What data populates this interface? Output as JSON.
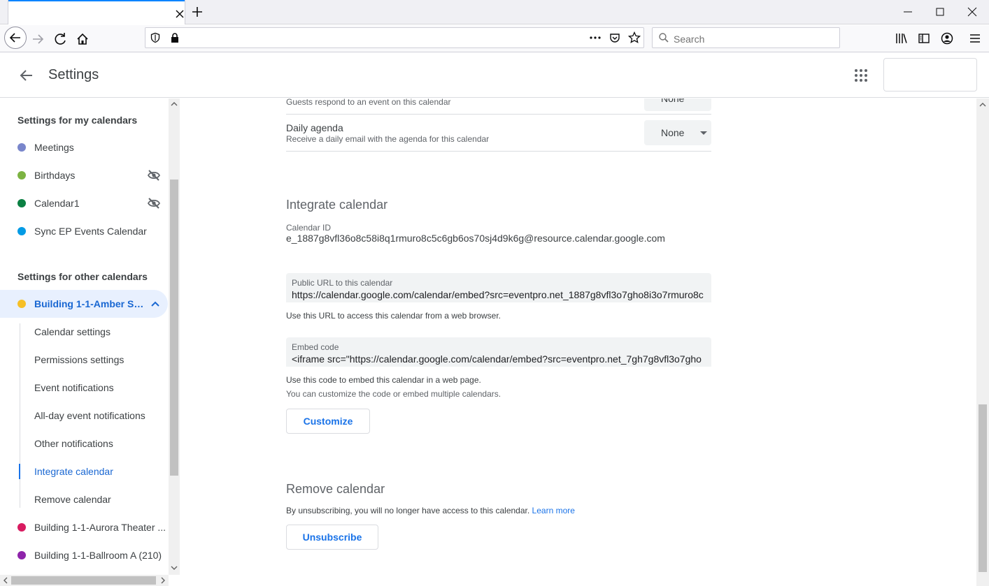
{
  "browser": {
    "search_placeholder": "Search"
  },
  "header": {
    "title": "Settings"
  },
  "sidebar": {
    "my_calendars_heading": "Settings for my calendars",
    "my_calendars": [
      {
        "label": "Meetings",
        "color": "#7986cb",
        "hidden": false
      },
      {
        "label": "Birthdays",
        "color": "#7cb342",
        "hidden": true
      },
      {
        "label": "Calendar1",
        "color": "#0b8043",
        "hidden": true
      },
      {
        "label": "Sync EP Events Calendar",
        "color": "#039be5",
        "hidden": false
      }
    ],
    "other_calendars_heading": "Settings for other calendars",
    "active_calendar": {
      "label": "Building 1-1-Amber Sa...",
      "color": "#f6bf26"
    },
    "sub_items": [
      "Calendar settings",
      "Permissions settings",
      "Event notifications",
      "All-day event notifications",
      "Other notifications",
      "Integrate calendar",
      "Remove calendar"
    ],
    "active_sub_item": "Integrate calendar",
    "other_calendars": [
      {
        "label": "Building 1-1-Aurora Theater ...",
        "color": "#d81b60"
      },
      {
        "label": "Building 1-1-Ballroom A (210)",
        "color": "#8e24aa"
      }
    ]
  },
  "main": {
    "guest_response": {
      "sub": "Guests respond to an event on this calendar",
      "value": "None"
    },
    "daily_agenda": {
      "title": "Daily agenda",
      "sub": "Receive a daily email with the agenda for this calendar",
      "value": "None"
    },
    "integrate": {
      "title": "Integrate calendar",
      "calendar_id_label": "Calendar ID",
      "calendar_id": "e_1887g8vfl36o8c58i8q1rmuro8c5c6gb6os70sj4d9k6g@resource.calendar.google.com",
      "public_url_label": "Public URL to this calendar",
      "public_url": "https://calendar.google.com/calendar/embed?src=eventpro.net_1887g8vfl3o7gho8i3o7rmuro8c",
      "public_url_help": "Use this URL to access this calendar from a web browser.",
      "embed_label": "Embed code",
      "embed_code": "<iframe src=\"https://calendar.google.com/calendar/embed?src=eventpro.net_7gh7g8vfl3o7gho",
      "embed_help": "Use this code to embed this calendar in a web page.",
      "embed_help2": "You can customize the code or embed multiple calendars.",
      "customize_label": "Customize"
    },
    "remove": {
      "title": "Remove calendar",
      "text": "By unsubscribing, you will no longer have access to this calendar.",
      "learn_more": "Learn more",
      "unsubscribe_label": "Unsubscribe"
    }
  }
}
